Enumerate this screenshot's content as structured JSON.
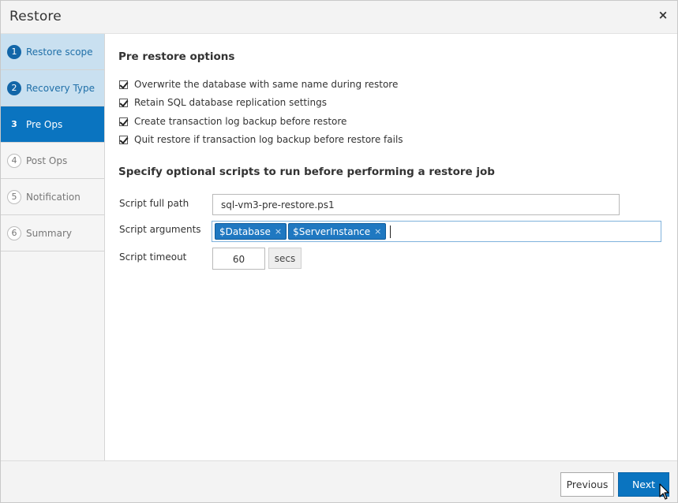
{
  "window": {
    "title": "Restore",
    "close_symbol": "×"
  },
  "steps": [
    {
      "num": "1",
      "label": "Restore scope",
      "state": "done"
    },
    {
      "num": "2",
      "label": "Recovery Type",
      "state": "done"
    },
    {
      "num": "3",
      "label": "Pre Ops",
      "state": "active"
    },
    {
      "num": "4",
      "label": "Post Ops",
      "state": "todo"
    },
    {
      "num": "5",
      "label": "Notification",
      "state": "todo"
    },
    {
      "num": "6",
      "label": "Summary",
      "state": "todo"
    }
  ],
  "pre_restore": {
    "heading": "Pre restore options",
    "options": [
      {
        "label": "Overwrite the database with same name during restore",
        "checked": true
      },
      {
        "label": "Retain SQL database replication settings",
        "checked": true
      },
      {
        "label": "Create transaction log backup before restore",
        "checked": true
      },
      {
        "label": "Quit restore if transaction log backup before restore fails",
        "checked": true
      }
    ]
  },
  "scripts": {
    "heading": "Specify optional scripts to run before performing a restore job",
    "path_label": "Script full path",
    "path_value": "sql-vm3-pre-restore.ps1",
    "args_label": "Script arguments",
    "args": [
      "$Database",
      "$ServerInstance"
    ],
    "tag_remove": "×",
    "timeout_label": "Script timeout",
    "timeout_value": "60",
    "timeout_unit": "secs"
  },
  "footer": {
    "previous": "Previous",
    "next": "Next"
  },
  "colors": {
    "accent": "#0a74c0",
    "done_step": "#c9e0f0",
    "tag": "#1f78c1"
  }
}
